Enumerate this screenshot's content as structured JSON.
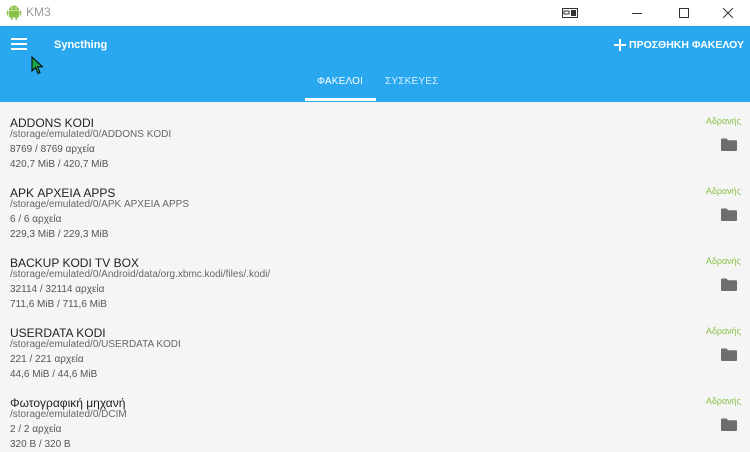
{
  "window": {
    "title": "KM3",
    "controls": [
      "tablet-mode-icon",
      "minimize-icon",
      "maximize-icon",
      "close-icon"
    ]
  },
  "appbar": {
    "app_name": "Syncthing",
    "add_folder_label": "ΠΡΟΣΘΗΚΗ ΦΑΚΕΛΟΥ",
    "tabs": [
      {
        "label": "ΦΑΚΕΛΟΙ",
        "active": true
      },
      {
        "label": "ΣΥΣΚΕΥΕΣ",
        "active": false
      }
    ],
    "color": "#29a8f0"
  },
  "folders": [
    {
      "name": "ADDONS KODI",
      "path": "/storage/emulated/0/ADDONS KODI",
      "files": "8769 / 8769 αρχεία",
      "size": "420,7 MiB / 420,7 MiB",
      "status": "Αδρανής"
    },
    {
      "name": "APK ΑΡΧΕΙΑ APPS",
      "path": "/storage/emulated/0/APK ΑΡΧΕΙΑ APPS",
      "files": "6 / 6 αρχεία",
      "size": "229,3 MiB / 229,3 MiB",
      "status": "Αδρανής"
    },
    {
      "name": "BACKUP KODI TV BOX",
      "path": "/storage/emulated/0/Android/data/org.xbmc.kodi/files/.kodi/",
      "files": "32114 / 32114 αρχεία",
      "size": "711,6 MiB / 711,6 MiB",
      "status": "Αδρανής"
    },
    {
      "name": "USERDATA KODI",
      "path": "/storage/emulated/0/USERDATA KODI",
      "files": "221 / 221 αρχεία",
      "size": "44,6 MiB / 44,6 MiB",
      "status": "Αδρανής"
    },
    {
      "name": "Φωτογραφική μηχανή",
      "path": "/storage/emulated/0/DCIM",
      "files": "2 / 2 αρχεία",
      "size": "320 B / 320 B",
      "status": "Αδρανής"
    }
  ],
  "status_color": "#8bc34a"
}
